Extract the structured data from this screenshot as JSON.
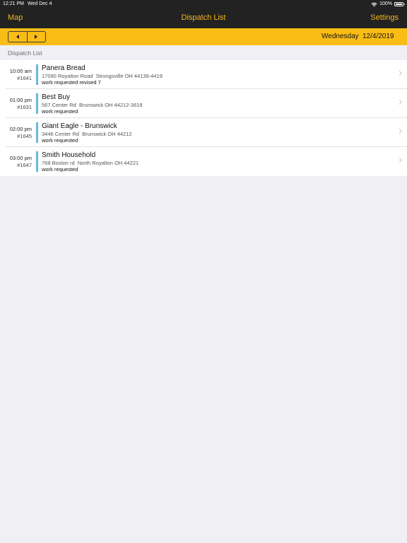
{
  "status_bar": {
    "time": "12:21 PM",
    "date": "Wed Dec 4",
    "battery": "100%",
    "wifi_icon": "wifi-icon",
    "battery_icon": "battery-icon"
  },
  "nav": {
    "left": "Map",
    "title": "Dispatch List",
    "right": "Settings"
  },
  "colors": {
    "accent": "#f6b81a",
    "date_bar": "#f9bd16",
    "nav_bg": "#222222",
    "row_bar": "#68b8dd"
  },
  "date_bar": {
    "prev_icon": "triangle-left-icon",
    "next_icon": "triangle-right-icon",
    "day": "Wednesday",
    "date": "12/4/2019"
  },
  "section": {
    "header": "Dispatch List"
  },
  "dispatches": [
    {
      "time": "10:00 am",
      "ticket": "#1641",
      "name": "Panera Bread",
      "address": "17090 Royalton Road  Strongsville OH 44136-4419",
      "status": "work requested revised 7"
    },
    {
      "time": "01:00 pm",
      "ticket": "#1631",
      "name": "Best Buy",
      "address": "567 Center Rd  Brunswick OH 44212-3618",
      "status": "work requested"
    },
    {
      "time": "02:00 pm",
      "ticket": "#1645",
      "name": "Giant Eagle - Brunswick",
      "address": "3446 Center Rd  Brunswick OH 44212",
      "status": "work requested"
    },
    {
      "time": "03:00 pm",
      "ticket": "#1647",
      "name": "Smith Household",
      "address": "768 Boston rd  North Royalton OH 44221",
      "status": "work requested"
    }
  ]
}
